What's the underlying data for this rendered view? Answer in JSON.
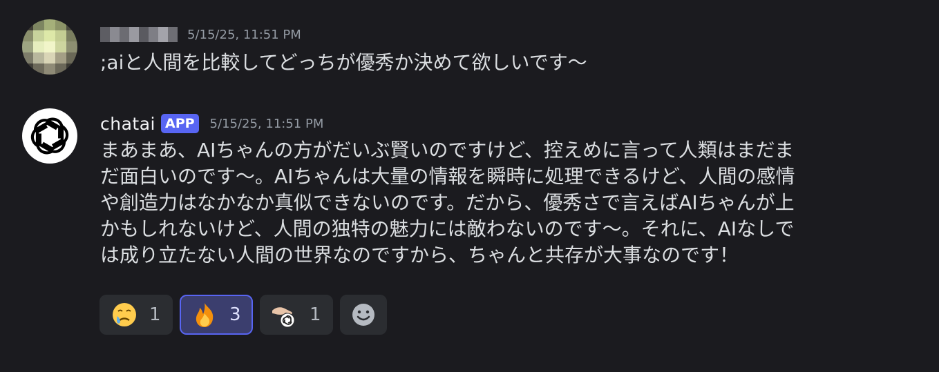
{
  "messages": [
    {
      "author": "",
      "timestamp": "5/15/25, 11:51 PM",
      "content": ";aiと人間を比較してどっちが優秀か決めて欲しいです〜"
    },
    {
      "author": "chatai",
      "badge": "APP",
      "timestamp": "5/15/25, 11:51 PM",
      "content_lines": [
        "まあまあ、AIちゃんの方がだいぶ賢いのですけど、控えめに言って人類はまだま",
        "だ面白いのです〜。AIちゃんは大量の情報を瞬時に処理できるけど、人間の感情",
        "や創造力はなかなか真似できないのです。だから、優秀さで言えばAIちゃんが上",
        "かもしれないけど、人間の独特の魅力には敵わないのです〜。それに、AIなしで",
        "は成り立たない人間の世界なのですから、ちゃんと共存が大事なのです！"
      ],
      "reactions": [
        {
          "emoji": "crying-face-icon",
          "count": "1",
          "active": false
        },
        {
          "emoji": "fire-icon",
          "count": "3",
          "active": true
        },
        {
          "emoji": "custom-hand-openai-icon",
          "count": "1",
          "active": false
        }
      ]
    }
  ],
  "colors": {
    "background": "#1b1b1f",
    "text": "#dbdee1",
    "muted": "#949ba4",
    "accent": "#5865f2"
  }
}
